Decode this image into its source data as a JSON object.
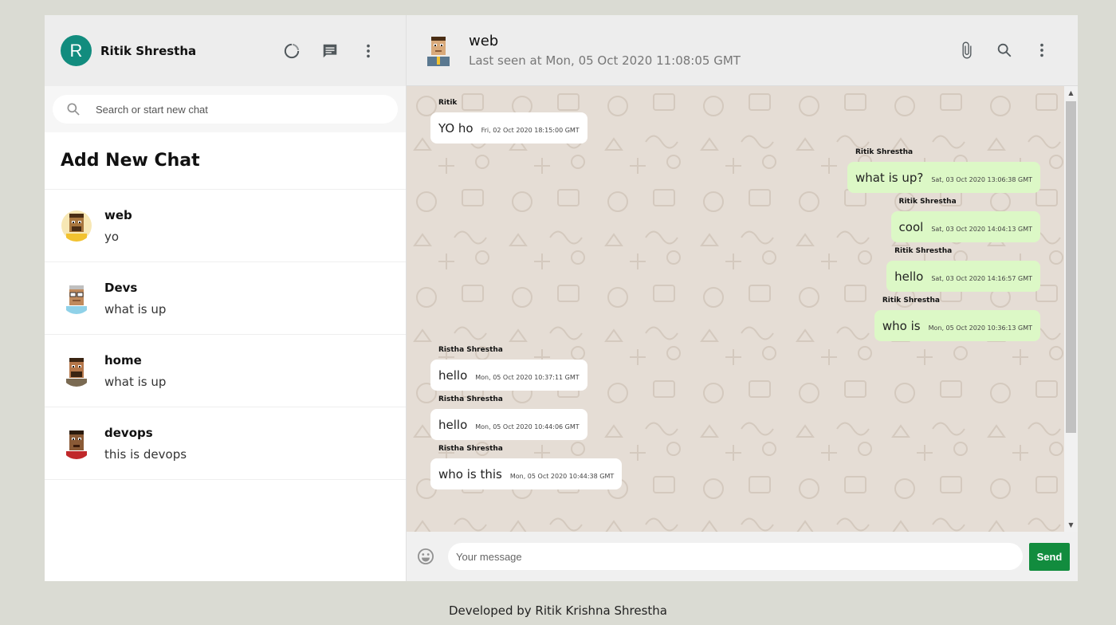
{
  "sidebar": {
    "user_initial": "R",
    "user_name": "Ritik Shrestha",
    "icons": [
      "status-icon",
      "new-chat-icon",
      "menu-dots-icon"
    ],
    "search_placeholder": "Search or start new chat",
    "add_new_chat": "Add New Chat",
    "chats": [
      {
        "name": "web",
        "last": "yo"
      },
      {
        "name": "Devs",
        "last": "what is up"
      },
      {
        "name": "home",
        "last": "what is up"
      },
      {
        "name": "devops",
        "last": "this is devops"
      }
    ]
  },
  "chat": {
    "name": "web",
    "last_seen": "Last seen at Mon, 05 Oct 2020 11:08:05 GMT",
    "icons": [
      "attach-icon",
      "search-icon",
      "menu-dots-icon"
    ],
    "messages": [
      {
        "sender": "Ritik",
        "text": "YO ho",
        "time": "Fri, 02 Oct 2020 18:15:00 GMT",
        "sent": false
      },
      {
        "sender": "Ritik Shrestha",
        "text": "what is up?",
        "time": "Sat, 03 Oct 2020 13:06:38 GMT",
        "sent": true
      },
      {
        "sender": "Ritik Shrestha",
        "text": "cool",
        "time": "Sat, 03 Oct 2020 14:04:13 GMT",
        "sent": true
      },
      {
        "sender": "Ritik Shrestha",
        "text": "hello",
        "time": "Sat, 03 Oct 2020 14:16:57 GMT",
        "sent": true
      },
      {
        "sender": "Ritik Shrestha",
        "text": "who is",
        "time": "Mon, 05 Oct 2020 10:36:13 GMT",
        "sent": true
      },
      {
        "sender": "Ristha Shrestha",
        "text": "hello",
        "time": "Mon, 05 Oct 2020 10:37:11 GMT",
        "sent": false
      },
      {
        "sender": "Ristha Shrestha",
        "text": "hello",
        "time": "Mon, 05 Oct 2020 10:44:06 GMT",
        "sent": false
      },
      {
        "sender": "Ristha Shrestha",
        "text": "who is this",
        "time": "Mon, 05 Oct 2020 10:44:38 GMT",
        "sent": false
      }
    ],
    "input_placeholder": "Your message",
    "send_label": "Send"
  },
  "footer_text": "Developed by Ritik Krishna Shrestha",
  "colors": {
    "accent": "#128c7e",
    "sent_bubble": "#dcf8c6",
    "send_button": "#128c3e",
    "page_bg": "#dadbd3"
  }
}
